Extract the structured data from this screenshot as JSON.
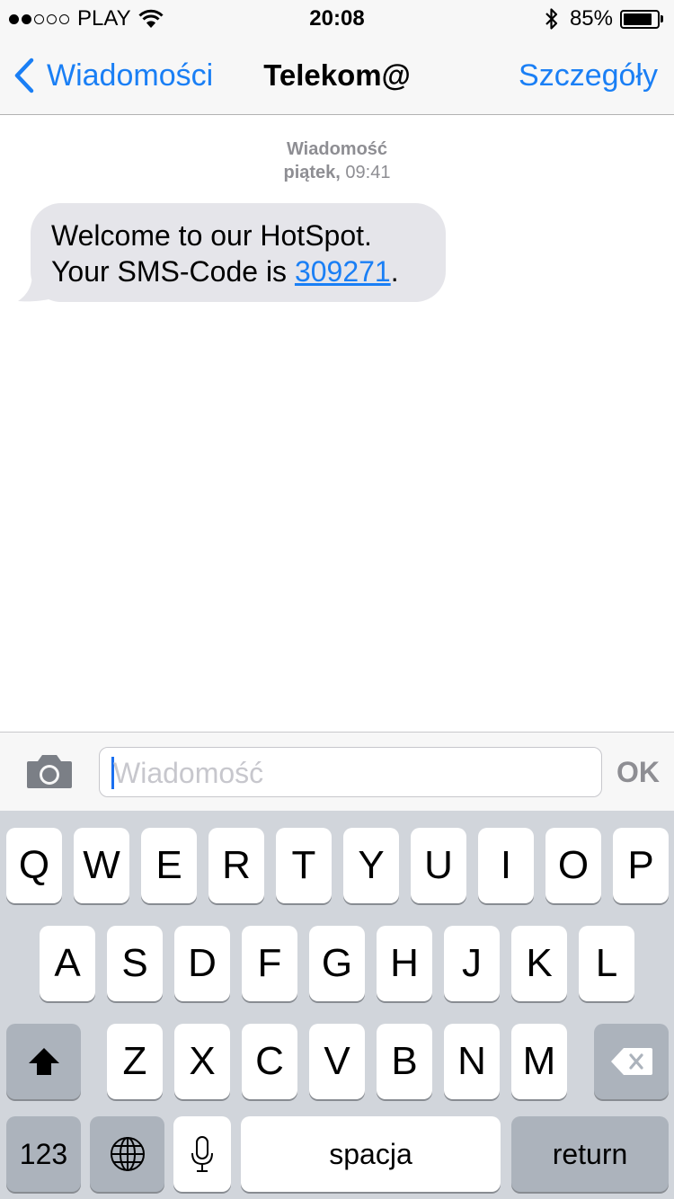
{
  "status_bar": {
    "signal_dots_filled": 2,
    "signal_dots_total": 5,
    "carrier": "PLAY",
    "time": "20:08",
    "battery_percent_label": "85%",
    "battery_level": 0.85,
    "icons": [
      "wifi-icon",
      "bluetooth-icon",
      "battery-icon"
    ]
  },
  "nav": {
    "back_label": "Wiadomości",
    "title": "Telekom@",
    "details_label": "Szczegóły"
  },
  "conversation": {
    "meta_service": "Wiadomość",
    "meta_day": "piątek,",
    "meta_time": "09:41",
    "message": {
      "line1": "Welcome to our HotSpot.",
      "line2_prefix": "Your SMS-Code is ",
      "code": "309271",
      "line2_suffix": "."
    }
  },
  "input_bar": {
    "placeholder": "Wiadomość",
    "send_label": "OK"
  },
  "keyboard": {
    "row1": [
      "Q",
      "W",
      "E",
      "R",
      "T",
      "Y",
      "U",
      "I",
      "O",
      "P"
    ],
    "row2": [
      "A",
      "S",
      "D",
      "F",
      "G",
      "H",
      "J",
      "K",
      "L"
    ],
    "row3": [
      "Z",
      "X",
      "C",
      "V",
      "B",
      "N",
      "M"
    ],
    "numbers_label": "123",
    "space_label": "spacja",
    "return_label": "return"
  },
  "colors": {
    "accent": "#1a7ff5",
    "bubble": "#e5e5ea",
    "keyboard_bg": "#d1d5db",
    "function_key": "#acb3bc"
  }
}
